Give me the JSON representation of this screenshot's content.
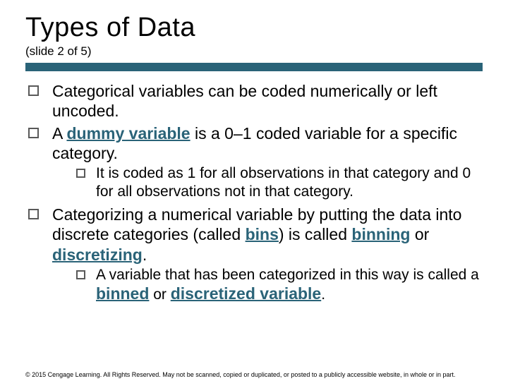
{
  "header": {
    "title": "Types of Data",
    "subtitle": "(slide 2 of 5)"
  },
  "bullets": {
    "b1": "Categorical variables can be coded numerically or left uncoded.",
    "b2_pre": "A ",
    "b2_kw": "dummy variable",
    "b2_post": " is a 0–1 coded variable for a specific category.",
    "b2_sub": "It is coded as 1 for all observations in that category and 0 for all observations not in that category.",
    "b3_pre": "Categorizing a numerical variable by putting the data into discrete categories (called ",
    "b3_kw1": "bins",
    "b3_mid1": ") is called ",
    "b3_kw2": "binning",
    "b3_mid2": " or ",
    "b3_kw3": "discretizing",
    "b3_post": ".",
    "b3_sub_pre": "A variable that has been categorized in this way is called a ",
    "b3_sub_kw1": "binned",
    "b3_sub_mid": " or ",
    "b3_sub_kw2": "discretized variable",
    "b3_sub_post": "."
  },
  "footer": {
    "copyright": "© 2015 Cengage Learning. All Rights Reserved. May not be scanned, copied or duplicated, or posted to a publicly accessible website, in whole or in part."
  }
}
